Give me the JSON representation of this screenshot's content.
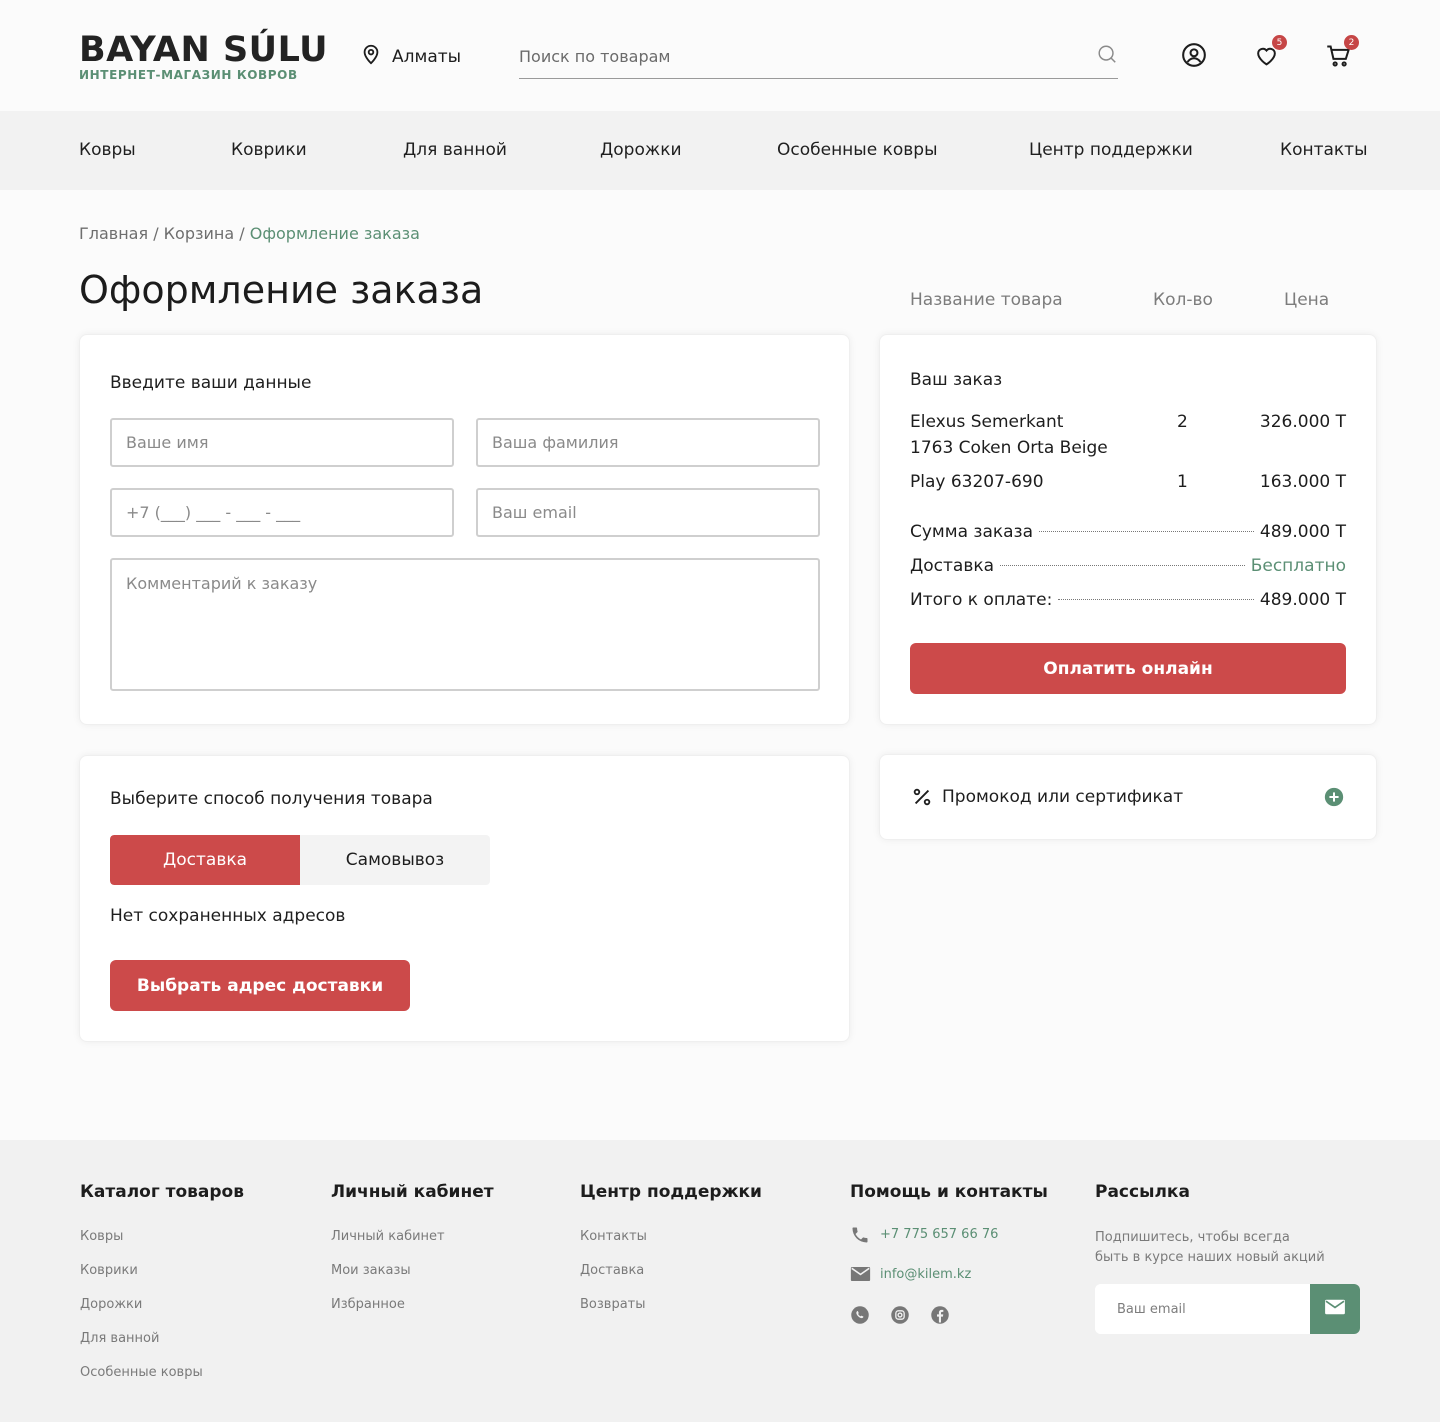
{
  "header": {
    "logo_main": "BAYAN SÚLU",
    "logo_sub": "ИНТЕРНЕТ-МАГАЗИН КОВРОВ",
    "city": "Алматы",
    "search_placeholder": "Поиск по товарам",
    "favorites_count": "5",
    "cart_count": "2"
  },
  "nav": [
    "Ковры",
    "Коврики",
    "Для ванной",
    "Дорожки",
    "Особенные ковры",
    "Центр поддержки",
    "Контакты"
  ],
  "breadcrumb": {
    "home": "Главная",
    "cart": "Корзина",
    "current": "Оформление заказа",
    "sep": " / "
  },
  "page_title": "Оформление заказа",
  "columns": {
    "name": "Название товара",
    "qty": "Кол-во",
    "price": "Цена"
  },
  "form": {
    "heading": "Введите ваши данные",
    "first_name_placeholder": "Ваше имя",
    "last_name_placeholder": "Ваша фамилия",
    "phone_placeholder": "+7 (___) ___ - ___ - ___",
    "email_placeholder": "Ваш email",
    "comment_placeholder": "Комментарий к заказу"
  },
  "delivery": {
    "heading": "Выберите способ получения товара",
    "option_delivery": "Доставка",
    "option_pickup": "Самовывоз",
    "no_addresses": "Нет сохраненных адресов",
    "choose_address_button": "Выбрать адрес доставки"
  },
  "order": {
    "heading": "Ваш заказ",
    "items": [
      {
        "name_line1": "Elexus Semerkant",
        "name_line2": "1763 Coken Orta Beige",
        "qty": "2",
        "price": "326.000 Т"
      },
      {
        "name_line1": "Play 63207-690",
        "qty": "1",
        "price": "163.000 Т"
      }
    ],
    "subtotal_label": "Сумма заказа",
    "subtotal_value": "489.000 Т",
    "delivery_label": "Доставка",
    "delivery_value": "Бесплатно",
    "total_label": "Итого к оплате:",
    "total_value": "489.000 Т",
    "pay_button": "Оплатить онлайн"
  },
  "promo": {
    "label": "Промокод или сертификат"
  },
  "footer": {
    "catalog": {
      "heading": "Каталог товаров",
      "links": [
        "Ковры",
        "Коврики",
        "Дорожки",
        "Для ванной",
        "Особенные ковры"
      ]
    },
    "account": {
      "heading": "Личный кабинет",
      "links": [
        "Личный кабинет",
        "Мои заказы",
        "Избранное"
      ]
    },
    "support": {
      "heading": "Центр поддержки",
      "links": [
        "Контакты",
        "Доставка",
        "Возвраты"
      ]
    },
    "contacts": {
      "heading": "Помощь и контакты",
      "phone": "+7 775 657 66 76",
      "email": "info@kilem.kz"
    },
    "newsletter": {
      "heading": "Рассылка",
      "text_line1": "Подпишитесь, чтобы всегда",
      "text_line2": "быть в курсе наших новый акций",
      "email_placeholder": "Ваш email"
    }
  },
  "colors": {
    "accent_red": "#cc4a4a",
    "accent_green": "#5b8f74"
  }
}
